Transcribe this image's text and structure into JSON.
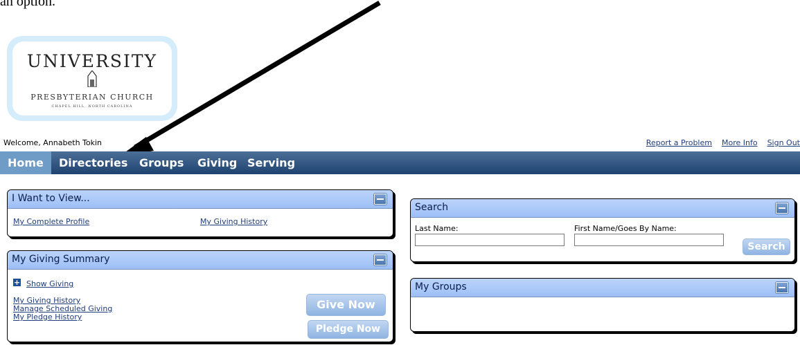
{
  "doc_fragment": "an option.",
  "logo": {
    "line1": "UNIVERSITY",
    "line2": "PRESBYTERIAN CHURCH",
    "line3": "CHAPEL HILL, NORTH CAROLINA"
  },
  "header": {
    "welcome": "Welcome, Annabeth Tokin",
    "links": [
      "Report a Problem",
      "More Info",
      "Sign Out"
    ]
  },
  "nav": [
    {
      "label": "Home",
      "active": true
    },
    {
      "label": "Directories"
    },
    {
      "label": "Groups"
    },
    {
      "label": "Giving"
    },
    {
      "label": "Serving"
    }
  ],
  "panels": {
    "view": {
      "title": "I Want to View...",
      "links": [
        "My Complete Profile",
        "My Giving History"
      ]
    },
    "giving": {
      "title": "My Giving Summary",
      "show_giving": "Show Giving",
      "links": [
        "My Giving History",
        "Manage Scheduled Giving",
        "My Pledge History"
      ],
      "give_now": "Give Now",
      "pledge_now": "Pledge Now"
    },
    "search": {
      "title": "Search",
      "last_name_label": "Last Name:",
      "first_name_label": "First Name/Goes By Name:",
      "last_name_value": "",
      "first_name_value": "",
      "button": "Search"
    },
    "groups": {
      "title": "My Groups"
    }
  },
  "colors": {
    "nav_bg": "#1f4370",
    "nav_active": "#6f9bc7",
    "panel_header": "#b3cdf7",
    "button": "#9dbce4",
    "link": "#1f3d78"
  }
}
